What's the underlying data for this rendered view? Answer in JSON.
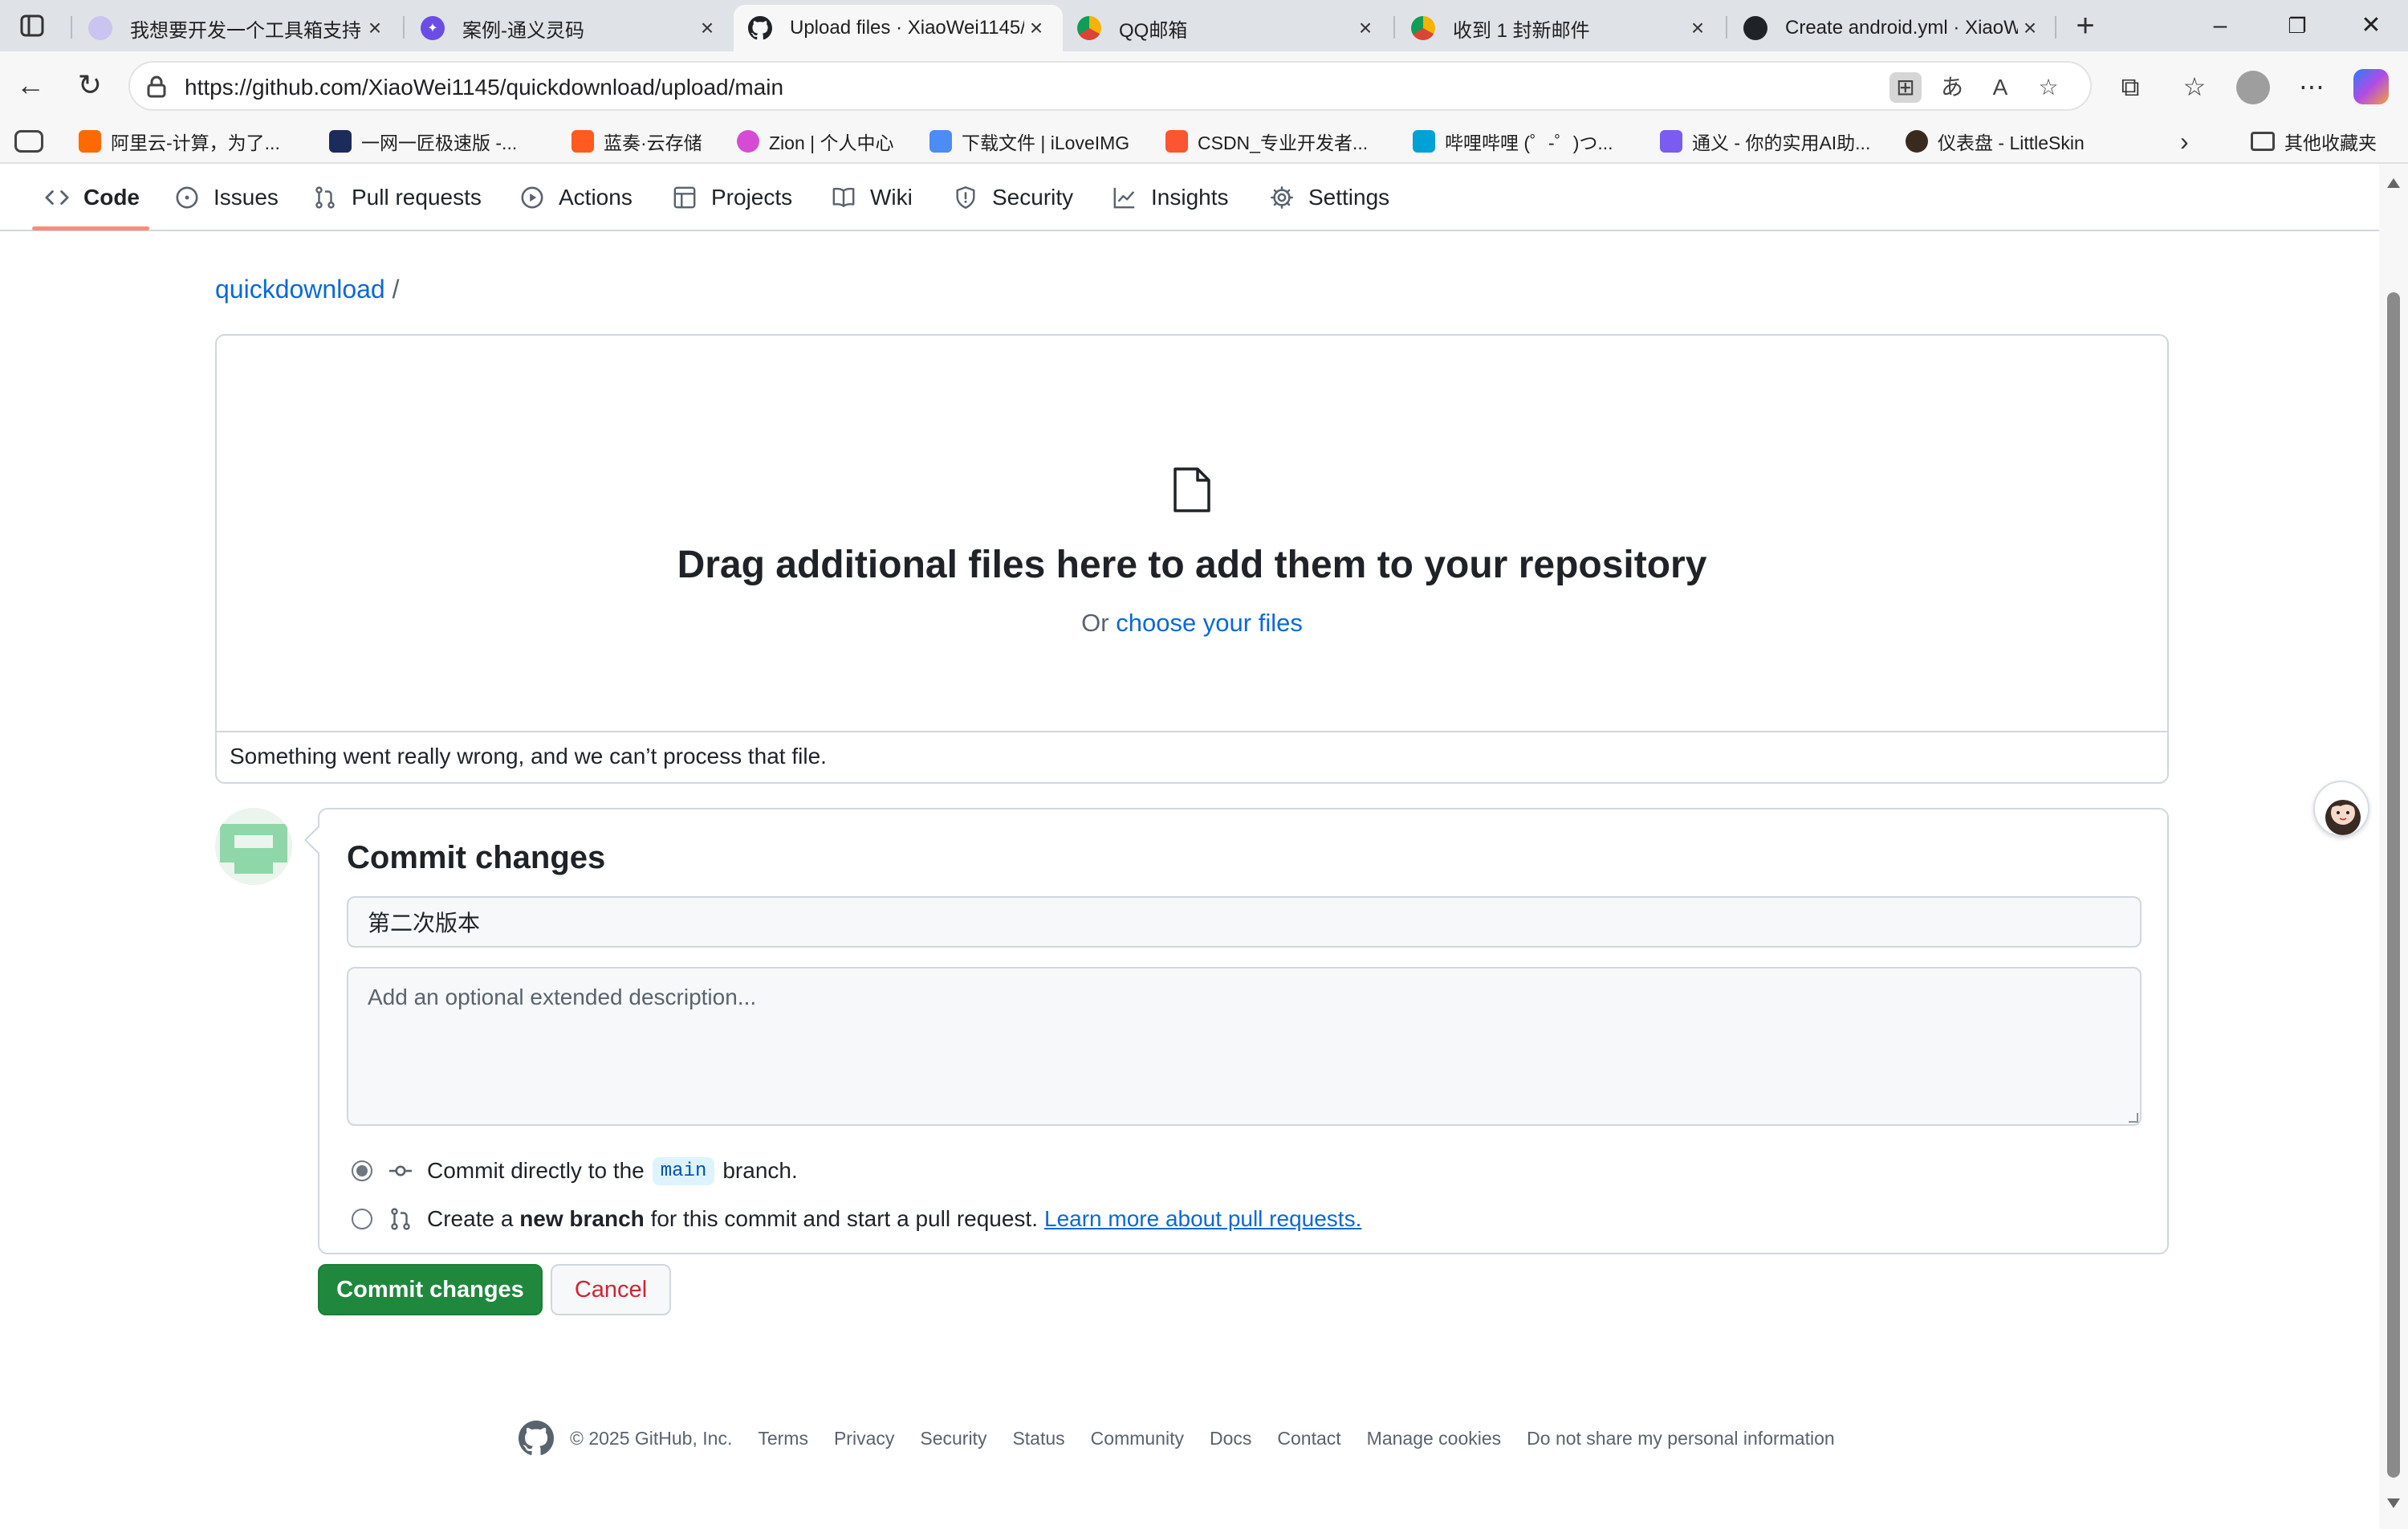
{
  "browser": {
    "tabs": [
      {
        "title": "我想要开发一个工具箱支持",
        "active": false
      },
      {
        "title": "案例-通义灵码",
        "active": false
      },
      {
        "title": "Upload files · XiaoWei1145/",
        "active": true
      },
      {
        "title": "QQ邮箱",
        "active": false
      },
      {
        "title": "收到 1 封新邮件",
        "active": false
      },
      {
        "title": "Create android.yml · XiaoW",
        "active": false
      }
    ],
    "url": "https://github.com/XiaoWei1145/quickdownload/upload/main",
    "bookmarks": [
      "阿里云-计算，为了...",
      "一网一匠极速版 -...",
      "蓝奏·云存储",
      "Zion | 个人中心",
      "下载文件 | iLoveIMG",
      "CSDN_专业开发者...",
      "哔哩哔哩 (゜-゜)つ...",
      "通义 - 你的实用AI助...",
      "仪表盘 - LittleSkin"
    ],
    "other_bookmarks": "其他收藏夹"
  },
  "repo_nav": [
    {
      "label": "Code",
      "icon": "code-icon"
    },
    {
      "label": "Issues",
      "icon": "issue-icon"
    },
    {
      "label": "Pull requests",
      "icon": "pull-request-icon"
    },
    {
      "label": "Actions",
      "icon": "play-icon"
    },
    {
      "label": "Projects",
      "icon": "table-icon"
    },
    {
      "label": "Wiki",
      "icon": "book-icon"
    },
    {
      "label": "Security",
      "icon": "shield-icon"
    },
    {
      "label": "Insights",
      "icon": "graph-icon"
    },
    {
      "label": "Settings",
      "icon": "gear-icon"
    }
  ],
  "breadcrumb": {
    "repo": "quickdownload",
    "separator": "/"
  },
  "dropzone": {
    "title": "Drag additional files here to add them to your repository",
    "or": "Or",
    "choose_link": "choose your files",
    "error": "Something went really wrong, and we can’t process that file."
  },
  "commit": {
    "heading": "Commit changes",
    "summary_value": "第二次版本",
    "description_placeholder": "Add an optional extended description...",
    "option_direct": {
      "pre": "Commit directly to the",
      "branch": "main",
      "post": "branch."
    },
    "option_new": {
      "pre": "Create a",
      "bold": "new branch",
      "post": "for this commit and start a pull request.",
      "link": "Learn more about pull requests."
    },
    "commit_button": "Commit changes",
    "cancel_button": "Cancel"
  },
  "footer": {
    "copyright": "© 2025 GitHub, Inc.",
    "links": [
      "Terms",
      "Privacy",
      "Security",
      "Status",
      "Community",
      "Docs",
      "Contact",
      "Manage cookies",
      "Do not share my personal information"
    ]
  },
  "colors": {
    "accent_link": "#0969da",
    "commit_green": "#1f883d",
    "cancel_red": "#d1242f",
    "nav_underline": "#fd8c73"
  }
}
